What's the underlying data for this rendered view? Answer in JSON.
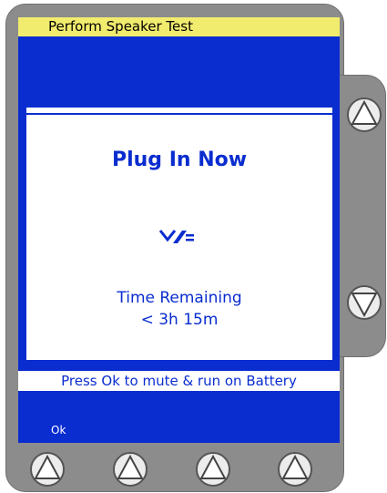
{
  "screen": {
    "title": "Perform Speaker Test",
    "info_message": "Press Ok to mute & run on Battery",
    "softkeys": [
      "Ok",
      "",
      "",
      ""
    ]
  },
  "dialog": {
    "heading": "Plug In Now",
    "icon": "plug-icon",
    "time_label": "Time Remaining",
    "time_value": "< 3h 15m"
  },
  "hardware": {
    "side_buttons": [
      "up-arrow-icon",
      "down-arrow-icon"
    ],
    "bottom_buttons": [
      "up-arrow-icon",
      "up-arrow-icon",
      "up-arrow-icon",
      "up-arrow-icon"
    ]
  },
  "colors": {
    "screen_bg": "#0a2dd0",
    "title_bar": "#f2ec6e",
    "device_body": "#8c8c8c",
    "dialog_bg": "#ffffff"
  }
}
